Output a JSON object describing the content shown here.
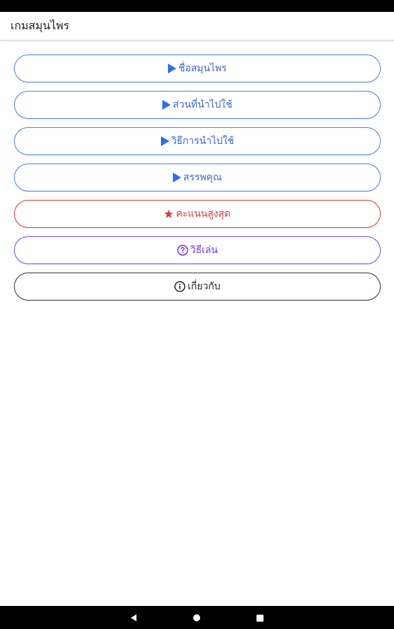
{
  "app": {
    "title": "เกมสมุนไพร"
  },
  "menu": {
    "items": [
      {
        "label": "ชื่อสมุนไพร",
        "icon": "play-icon",
        "color": "#4d7cf6"
      },
      {
        "label": "ส่วนที่นำไปใช้",
        "icon": "play-icon",
        "color": "#4d7cf6"
      },
      {
        "label": "วิธีการนำไปใช้",
        "icon": "play-icon",
        "color": "#4d7cf6"
      },
      {
        "label": "สรรพคุณ",
        "icon": "play-icon",
        "color": "#4d7cf6"
      },
      {
        "label": "คะแนนสูงสุด",
        "icon": "star-icon",
        "color": "#e0383e"
      },
      {
        "label": "วิธีเล่น",
        "icon": "question-circle-icon",
        "color": "#7b47f5"
      },
      {
        "label": "เกี่ยวกับ",
        "icon": "info-circle-icon",
        "color": "#222222"
      }
    ]
  },
  "navigation": {
    "buttons": [
      "back-icon",
      "home-icon",
      "recents-icon"
    ]
  }
}
